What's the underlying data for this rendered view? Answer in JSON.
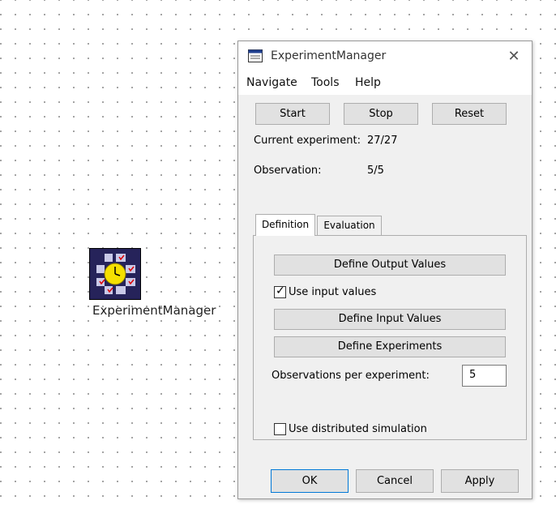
{
  "canvas": {
    "object_label": "ExperimentManager",
    "object_icon": "experiment-manager-icon"
  },
  "window": {
    "title": "ExperimentManager",
    "close": "✕"
  },
  "menu": [
    "Navigate",
    "Tools",
    "Help"
  ],
  "controls": {
    "start": "Start",
    "stop": "Stop",
    "reset": "Reset"
  },
  "status": {
    "current_label": "Current experiment:",
    "current_value": "27/27",
    "observation_label": "Observation:",
    "observation_value": "5/5"
  },
  "tabs": [
    "Definition",
    "Evaluation"
  ],
  "definition": {
    "define_output": "Define Output Values",
    "use_input_label": "Use input values",
    "use_input_checked": true,
    "define_input": "Define Input Values",
    "define_experiments": "Define Experiments",
    "obs_per_exp_label": "Observations per experiment:",
    "obs_per_exp_value": "5",
    "use_distributed_label": "Use distributed simulation",
    "use_distributed_checked": false
  },
  "footer": {
    "ok": "OK",
    "cancel": "Cancel",
    "apply": "Apply"
  },
  "colors": {
    "icon_bg": "#26235a",
    "clock_yellow": "#f5e000",
    "accent": "#0078d7"
  }
}
